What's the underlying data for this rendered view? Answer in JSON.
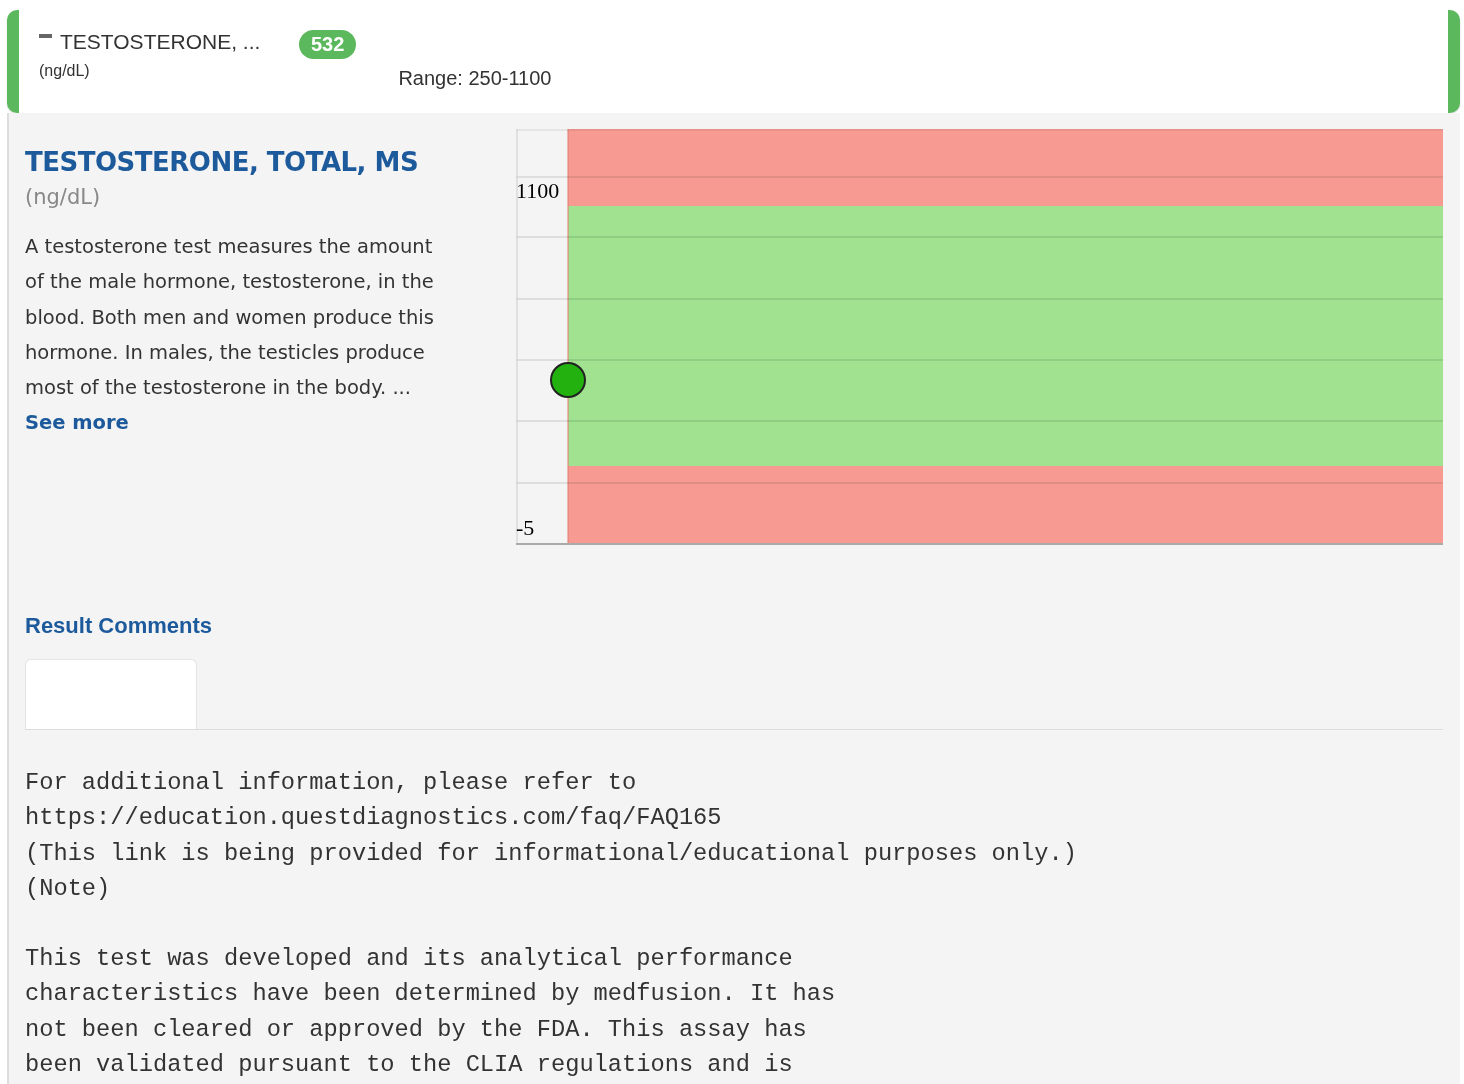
{
  "header": {
    "test_name": "TESTOSTERONE, ...",
    "unit": "(ng/dL)",
    "result": "532",
    "range": "Range: 250-1100"
  },
  "detail": {
    "title": "TESTOSTERONE, TOTAL, MS",
    "unit": "(ng/dL)",
    "description": "A testosterone test measures the amount of the male hormone, testosterone, in the blood. Both men and women produce this hormone. In males, the testicles produce most of the testosterone in the body. ...",
    "see_more": "See more"
  },
  "chart": {
    "y_labels": [
      "1100",
      "-5"
    ]
  },
  "result_comments": {
    "heading": "Result Comments",
    "paragraphs": [
      "For additional information, please refer to\nhttps://education.questdiagnostics.com/faq/FAQ165\n(This link is being provided for informational/educational purposes only.)\n(Note)",
      "This test was developed and its analytical performance\ncharacteristics have been determined by medfusion. It has\nnot been cleared or approved by the FDA. This assay has\nbeen validated pursuant to the CLIA regulations and is"
    ]
  }
}
